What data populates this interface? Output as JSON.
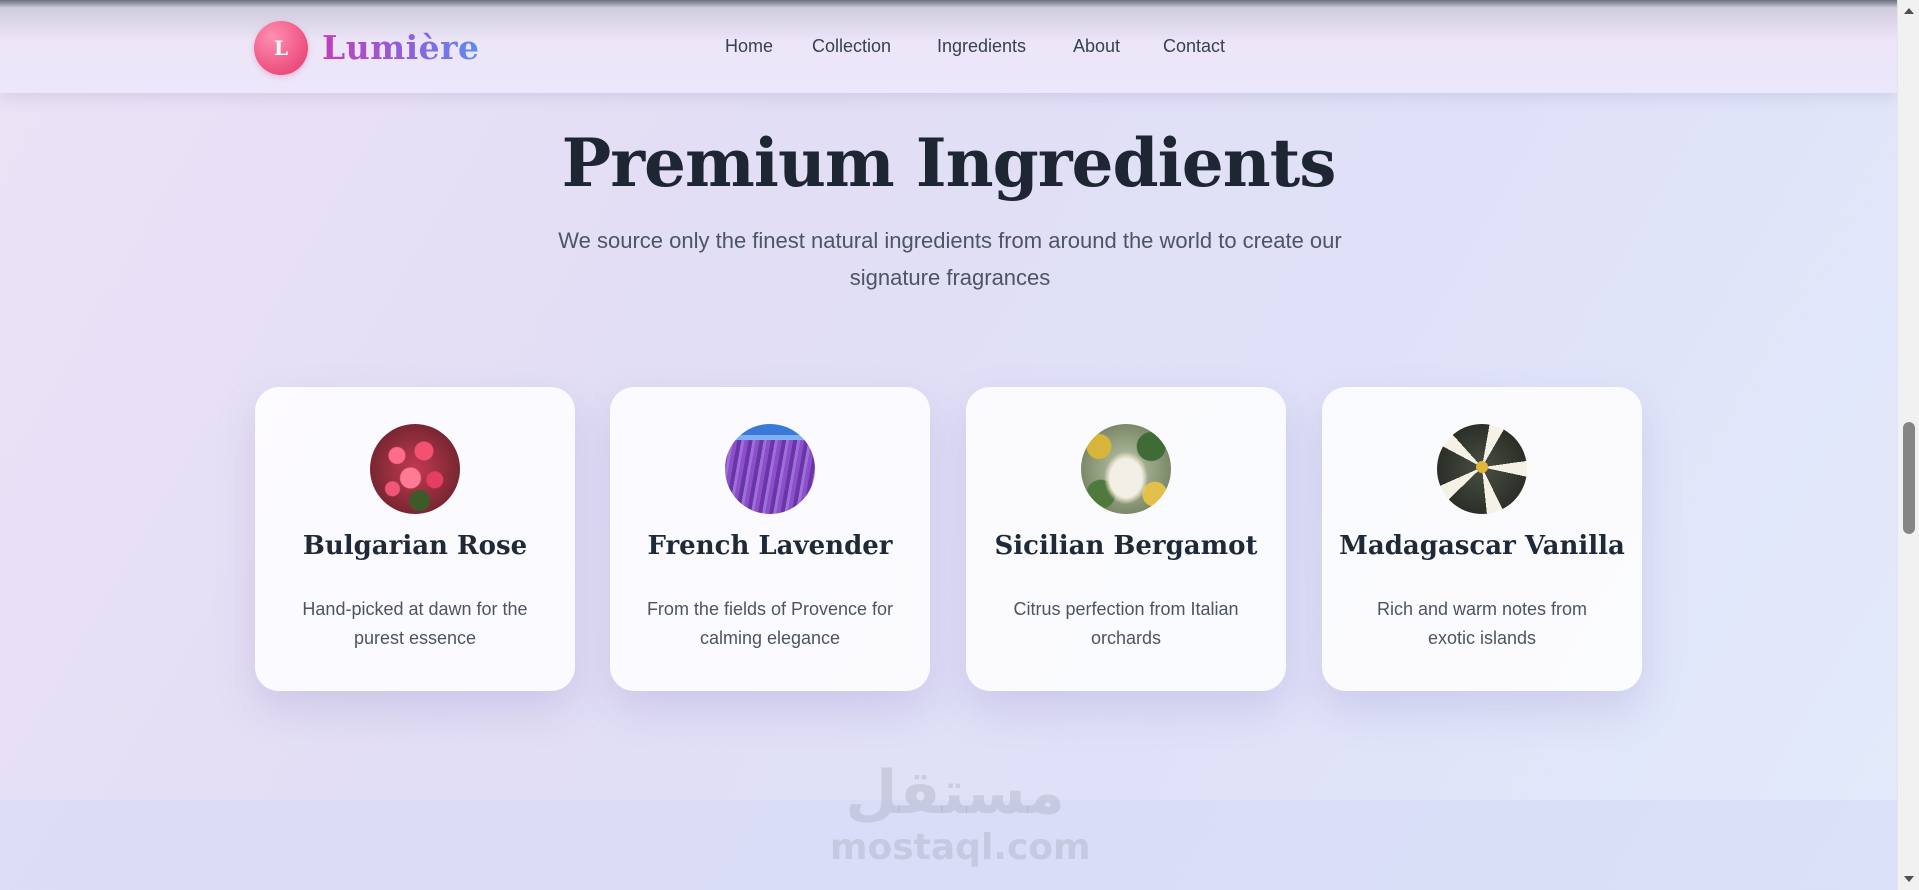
{
  "brand": {
    "logo_letter": "L",
    "name": "Lumière"
  },
  "nav": [
    "Home",
    "Collection",
    "Ingredients",
    "About",
    "Contact"
  ],
  "hero": {
    "title": "Premium Ingredients",
    "subtitle": "We source only the finest natural ingredients from around the world to create our signature fragrances"
  },
  "ingredients": [
    {
      "name": "Bulgarian Rose",
      "description": "Hand-picked at dawn for the purest essence",
      "image": "roses-photo"
    },
    {
      "name": "French Lavender",
      "description": "From the fields of Provence for calming elegance",
      "image": "lavender-field-photo"
    },
    {
      "name": "Sicilian Bergamot",
      "description": "Citrus perfection from Italian orchards",
      "image": "bergamot-bottle-photo"
    },
    {
      "name": "Madagascar Vanilla",
      "description": "Rich and warm notes from exotic islands",
      "image": "vanilla-flower-photo"
    }
  ],
  "watermark": {
    "arabic": "مستقل",
    "latin": "mostaql.com"
  },
  "colors": {
    "brand_pink": "#ec4f7e",
    "brand_purple": "#8f5fe0",
    "brand_blue": "#5b8df0",
    "heading": "#1e2533",
    "body_text": "#4b5563"
  }
}
